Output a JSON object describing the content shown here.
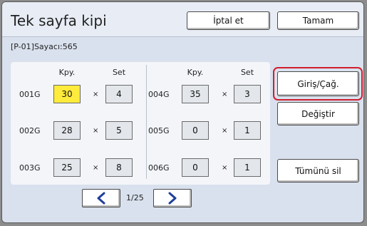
{
  "window": {
    "title": "Tek sayfa kipi"
  },
  "header": {
    "cancel_label": "İptal et",
    "ok_label": "Tamam"
  },
  "counter": "[P-01]Sayacı:565",
  "table": {
    "col_headers": {
      "copies": "Kpy.",
      "sets": "Set"
    },
    "times": "×",
    "left_rows": [
      {
        "label": "001G",
        "copies": "30",
        "sets": "4"
      },
      {
        "label": "002G",
        "copies": "28",
        "sets": "5"
      },
      {
        "label": "003G",
        "copies": "25",
        "sets": "8"
      }
    ],
    "right_rows": [
      {
        "label": "004G",
        "copies": "35",
        "sets": "3"
      },
      {
        "label": "005G",
        "copies": "0",
        "sets": "1"
      },
      {
        "label": "006G",
        "copies": "0",
        "sets": "1"
      }
    ]
  },
  "actions": {
    "entry_label": "Giriş/Çağ.",
    "change_label": "Değiştir",
    "clear_all_label": "Tümünü sil"
  },
  "pagination": {
    "page": "1/25"
  },
  "colors": {
    "active_cell": "#ffeb3b",
    "focus_ring": "#d21e2d",
    "arrow": "#1f3f9a"
  }
}
